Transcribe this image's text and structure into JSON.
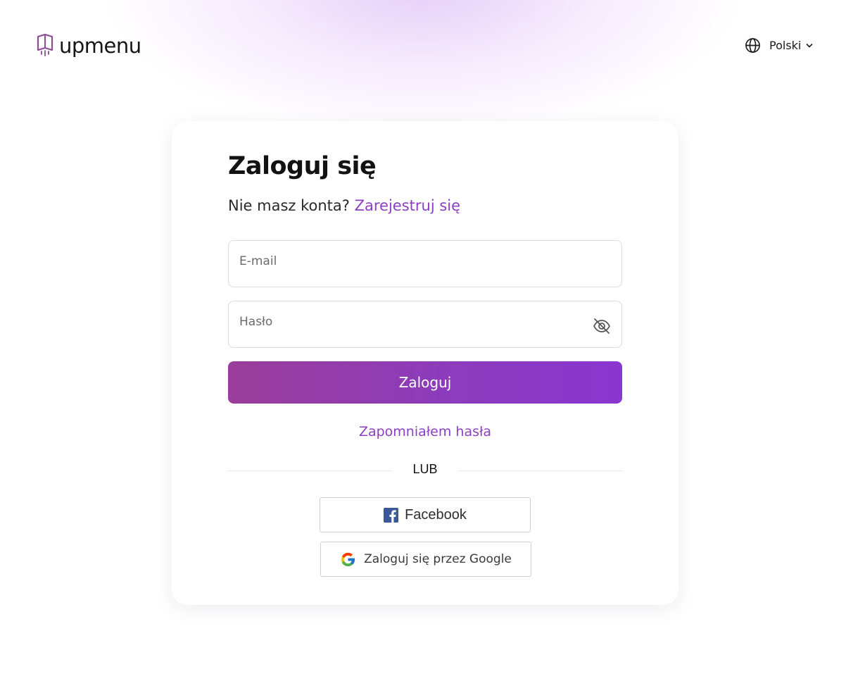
{
  "header": {
    "logo_text": "upmenu",
    "language": "Polski"
  },
  "login": {
    "title": "Zaloguj się",
    "no_account_text": "Nie masz konta?",
    "register_link": "Zarejestruj się",
    "email_placeholder": "E-mail",
    "password_placeholder": "Hasło",
    "submit_label": "Zaloguj",
    "forgot_password": "Zapomniałem hasła",
    "divider_text": "LUB",
    "facebook_label": "Facebook",
    "google_label": "Zaloguj się przez Google"
  },
  "colors": {
    "accent": "#8d3fc4",
    "button_gradient_start": "#9b3e9b",
    "button_gradient_end": "#8a37d0",
    "facebook_blue": "#3b5998"
  },
  "icons": {
    "logo": "upmenu-logo-icon",
    "language": "globe-icon",
    "language_dropdown": "chevron-down-icon",
    "password_toggle": "eye-off-icon",
    "facebook": "facebook-icon",
    "google": "google-icon"
  }
}
